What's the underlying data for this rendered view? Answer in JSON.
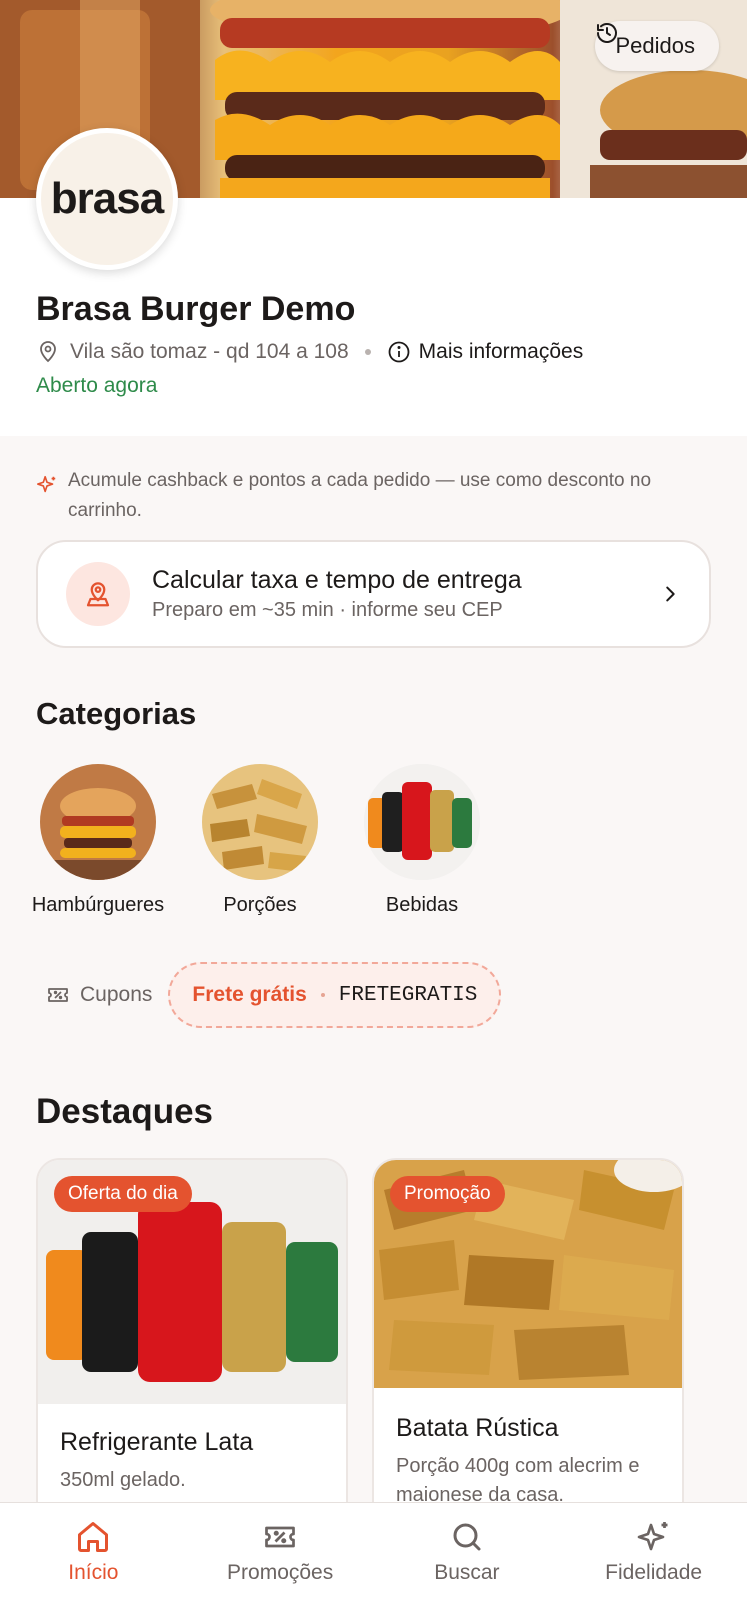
{
  "header": {
    "orders_label": "Pedidos"
  },
  "store": {
    "logo_text": "brasa",
    "name": "Brasa Burger Demo",
    "address": "Vila são tomaz - qd 104 a 108",
    "more_info": "Mais informações",
    "status": "Aberto agora"
  },
  "cashback": {
    "text": "Acumule cashback e pontos a cada pedido — use como desconto no carrinho."
  },
  "delivery": {
    "title": "Calcular taxa e tempo de entrega",
    "subtitle": "Preparo em ~35 min · informe seu CEP"
  },
  "categories": {
    "title": "Categorias",
    "items": [
      {
        "label": "Hambúrgueres"
      },
      {
        "label": "Porções"
      },
      {
        "label": "Bebidas"
      }
    ]
  },
  "coupons": {
    "label": "Cupons",
    "chip_name": "Frete grátis",
    "chip_code": "FRETEGRATIS"
  },
  "highlights": {
    "title": "Destaques",
    "items": [
      {
        "badge": "Oferta do dia",
        "title": "Refrigerante Lata",
        "desc": "350ml gelado."
      },
      {
        "badge": "Promoção",
        "title": "Batata Rústica",
        "desc": "Porção 400g com alecrim e maionese da casa."
      }
    ]
  },
  "nav": {
    "items": [
      {
        "label": "Início",
        "icon": "home-icon"
      },
      {
        "label": "Promoções",
        "icon": "coupon-icon"
      },
      {
        "label": "Buscar",
        "icon": "search-icon"
      },
      {
        "label": "Fidelidade",
        "icon": "sparkles-icon"
      }
    ]
  },
  "colors": {
    "accent": "#e4532f",
    "open": "#2e8b4a",
    "background": "#faf7f6"
  }
}
